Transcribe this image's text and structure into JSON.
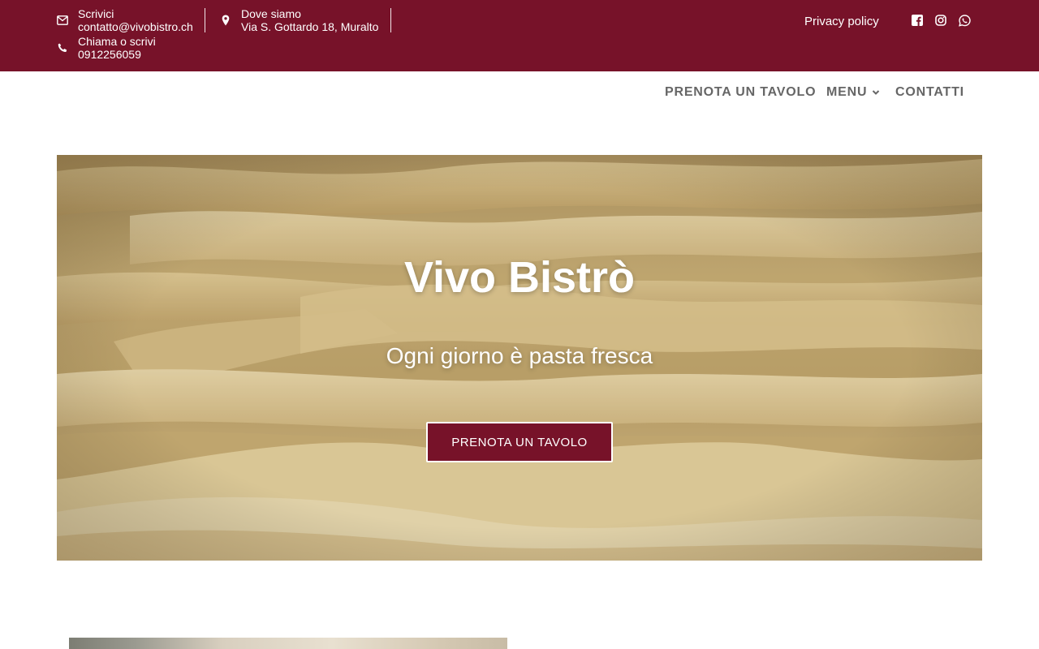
{
  "topbar": {
    "email_label": "Scrivici",
    "email_value": "contatto@vivobistro.ch",
    "address_label": "Dove siamo",
    "address_value": "Via S. Gottardo 18, Muralto",
    "phone_label": "Chiama o scrivi",
    "phone_value": "0912256059",
    "privacy_label": "Privacy policy",
    "social_icons": [
      "facebook-icon",
      "instagram-icon",
      "whatsapp-icon"
    ],
    "background_color": "#771229"
  },
  "nav": {
    "items": [
      {
        "label": "PRENOTA UN TAVOLO"
      },
      {
        "label": "MENU"
      },
      {
        "label": "CONTATTI"
      }
    ]
  },
  "hero": {
    "title": "Vivo Bistrò",
    "subtitle": "Ogni giorno è pasta fresca",
    "button_label": "PRENOTA UN TAVOLO",
    "button_color": "#771229"
  }
}
